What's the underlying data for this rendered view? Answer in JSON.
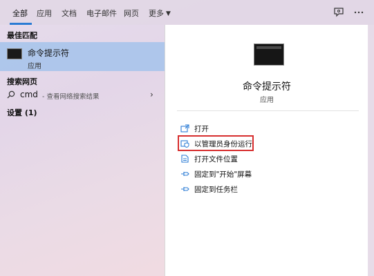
{
  "tabs": [
    {
      "label": "全部"
    },
    {
      "label": "应用"
    },
    {
      "label": "文档"
    },
    {
      "label": "电子邮件"
    },
    {
      "label": "网页"
    },
    {
      "label": "更多"
    }
  ],
  "best_match": {
    "heading": "最佳匹配",
    "title": "命令提示符",
    "subtitle": "应用"
  },
  "web": {
    "heading": "搜索网页",
    "query": "cmd",
    "hint": "- 查看网络搜索结果"
  },
  "settings": {
    "heading": "设置 (1)"
  },
  "detail": {
    "app_name": "命令提示符",
    "app_type": "应用",
    "actions": [
      {
        "label": "打开",
        "icon": "open-icon"
      },
      {
        "label": "以管理员身份运行",
        "icon": "shield-icon"
      },
      {
        "label": "打开文件位置",
        "icon": "file-location-icon"
      },
      {
        "label": "固定到\"开始\"屏幕",
        "icon": "pin-icon"
      },
      {
        "label": "固定到任务栏",
        "icon": "pin-icon"
      }
    ]
  },
  "colors": {
    "accent": "#2a7bd4",
    "selection": "#a5c3eb",
    "highlight_box": "#d72d2d"
  }
}
